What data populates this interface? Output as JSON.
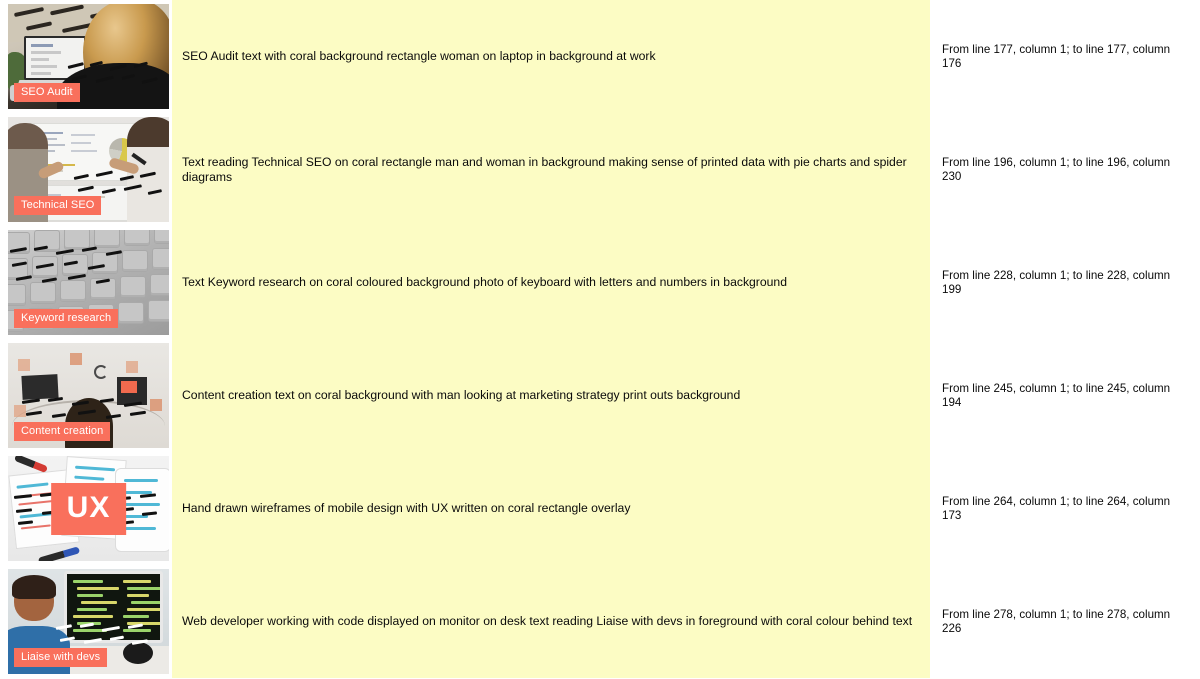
{
  "document": {
    "type": "alt-text-audit-table",
    "columns": [
      "thumbnail",
      "alt_text",
      "source_location"
    ],
    "colors": {
      "highlight_background": "#fcfcc4",
      "badge_coral": "#f9705c",
      "page_background": "#ffffff",
      "text": "#0a0a0a"
    }
  },
  "rows": [
    {
      "image": {
        "name": "seo-audit-thumbnail",
        "badge": "SEO Audit",
        "badge_style": "small",
        "description": "woman working on laptop"
      },
      "alt_text": "SEO Audit text with coral background rectangle woman on laptop in background at work",
      "location": "From line 177, column 1; to line 177, column 176"
    },
    {
      "image": {
        "name": "technical-seo-thumbnail",
        "badge": "Technical SEO",
        "badge_style": "small",
        "description": "man and woman at whiteboard with charts"
      },
      "alt_text": "Text reading Technical SEO on coral rectangle man and woman in background making sense of printed data with pie charts and spider diagrams",
      "location": "From line 196, column 1; to line 196, column 230"
    },
    {
      "image": {
        "name": "keyword-research-thumbnail",
        "badge": "Keyword research",
        "badge_style": "small",
        "description": "close up of keyboard keys"
      },
      "alt_text": "Text Keyword research on coral coloured background photo of keyboard with letters and numbers in background",
      "location": "From line 228, column 1; to line 228, column 199"
    },
    {
      "image": {
        "name": "content-creation-thumbnail",
        "badge": "Content creation",
        "badge_style": "small",
        "description": "man looking at marketing strategy print outs"
      },
      "alt_text": "Content creation text on coral background with man looking at marketing strategy print outs background",
      "location": "From line 245, column 1; to line 245, column 194"
    },
    {
      "image": {
        "name": "ux-thumbnail",
        "badge": "UX",
        "badge_style": "large",
        "description": "hand drawn mobile wireframes with pens"
      },
      "alt_text": "Hand drawn wireframes of mobile design with UX written on coral rectangle overlay",
      "location": "From line 264, column 1; to line 264, column 173"
    },
    {
      "image": {
        "name": "liaise-with-devs-thumbnail",
        "badge": "Liaise with devs",
        "badge_style": "small",
        "description": "web developer working with code on monitor"
      },
      "alt_text": "Web developer working with code displayed on monitor on desk text reading Liaise with devs in foreground with coral colour behind text",
      "location": "From line 278, column 1; to line 278, column 226"
    }
  ]
}
